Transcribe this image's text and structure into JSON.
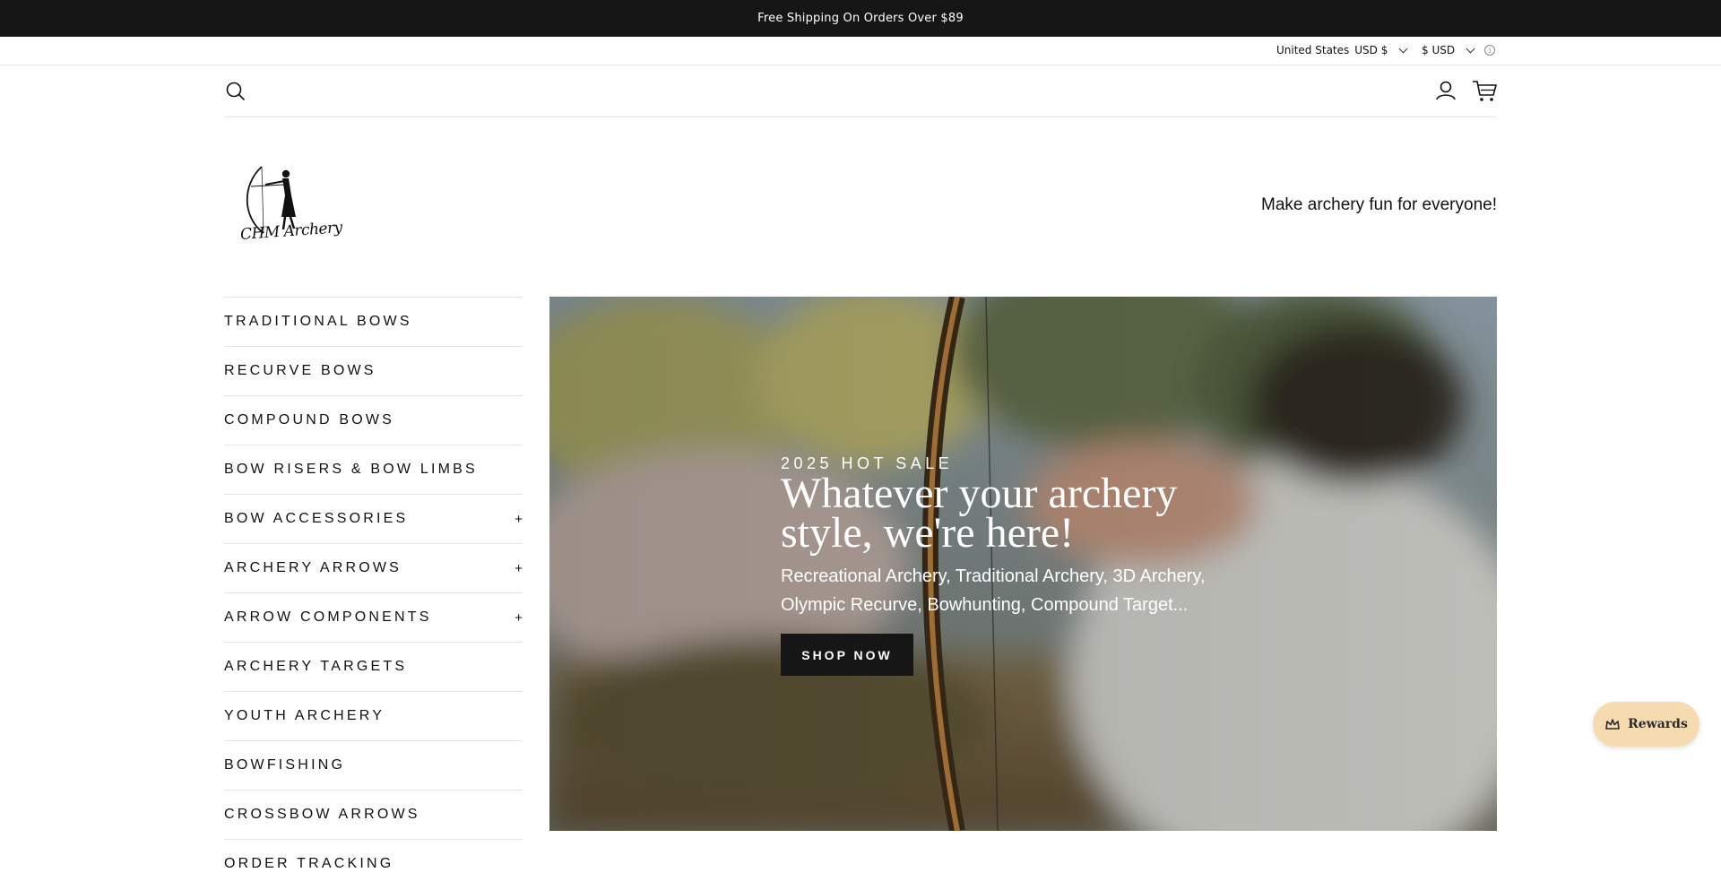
{
  "announcement": {
    "text": "Free Shipping On Orders Over $89"
  },
  "utility": {
    "country_label": "United States",
    "country_currency": "USD $",
    "currency_label": "$ USD",
    "info_glyph": "i"
  },
  "header": {
    "icons": [
      "search-icon",
      "account-icon",
      "cart-icon"
    ]
  },
  "brand": {
    "logo_text": "CHM Archery",
    "tagline": "Make archery fun for everyone!"
  },
  "nav": {
    "items": [
      {
        "label": "TRADITIONAL BOWS",
        "expand": ""
      },
      {
        "label": "RECURVE BOWS",
        "expand": ""
      },
      {
        "label": "COMPOUND BOWS",
        "expand": ""
      },
      {
        "label": "BOW RISERS & BOW LIMBS",
        "expand": ""
      },
      {
        "label": "BOW ACCESSORIES",
        "expand": "+"
      },
      {
        "label": "ARCHERY ARROWS",
        "expand": "+"
      },
      {
        "label": "ARROW COMPONENTS",
        "expand": "+"
      },
      {
        "label": "ARCHERY TARGETS",
        "expand": ""
      },
      {
        "label": "YOUTH ARCHERY",
        "expand": ""
      },
      {
        "label": "BOWFISHING",
        "expand": ""
      },
      {
        "label": "CROSSBOW ARROWS",
        "expand": ""
      },
      {
        "label": "ORDER TRACKING",
        "expand": ""
      }
    ]
  },
  "hero": {
    "eyebrow": "2025 HOT SALE",
    "headline": "Whatever your archery style, we're here!",
    "subtext": "Recreational Archery, Traditional Archery, 3D Archery, Olympic Recurve, Bowhunting, Compound Target...",
    "cta": "SHOP NOW"
  },
  "rewards": {
    "label": "Rewards"
  },
  "colors": {
    "announce_bg": "#161616",
    "rewards_bg": "#f7dbb0",
    "button_bg": "#161616"
  }
}
